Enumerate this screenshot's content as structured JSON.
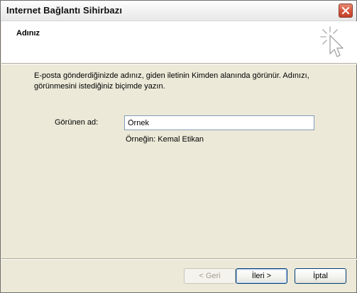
{
  "window": {
    "title": "Internet Bağlantı Sihirbazı"
  },
  "header": {
    "title": "Adınız"
  },
  "body": {
    "description": "E-posta gönderdiğinizde adınız, giden iletinin Kimden alanında görünür. Adınızı, görünmesini istediğiniz biçimde yazın.",
    "display_name_label": "Görünen ad:",
    "display_name_value": "Örnek",
    "example": "Örneğin: Kemal Etikan"
  },
  "buttons": {
    "back": "< Geri",
    "next": "İleri >",
    "cancel": "İptal"
  },
  "icons": {
    "close": "close-icon",
    "wizard": "wizard-cursor-icon"
  },
  "colors": {
    "dialog_bg": "#ECE9D8",
    "header_bg": "#FFFFFF",
    "close_red": "#D6533B"
  }
}
